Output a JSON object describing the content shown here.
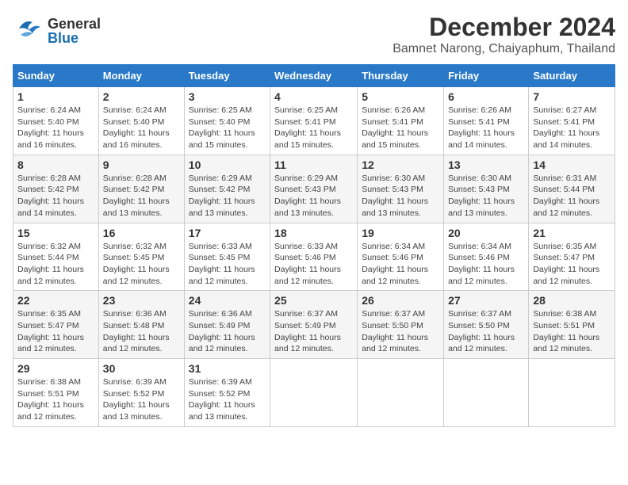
{
  "header": {
    "logo": {
      "general": "General",
      "blue": "Blue"
    },
    "month": "December 2024",
    "location": "Bamnet Narong, Chaiyaphum, Thailand"
  },
  "weekdays": [
    "Sunday",
    "Monday",
    "Tuesday",
    "Wednesday",
    "Thursday",
    "Friday",
    "Saturday"
  ],
  "weeks": [
    [
      {
        "day": "1",
        "sunrise": "Sunrise: 6:24 AM",
        "sunset": "Sunset: 5:40 PM",
        "daylight": "Daylight: 11 hours and 16 minutes."
      },
      {
        "day": "2",
        "sunrise": "Sunrise: 6:24 AM",
        "sunset": "Sunset: 5:40 PM",
        "daylight": "Daylight: 11 hours and 16 minutes."
      },
      {
        "day": "3",
        "sunrise": "Sunrise: 6:25 AM",
        "sunset": "Sunset: 5:40 PM",
        "daylight": "Daylight: 11 hours and 15 minutes."
      },
      {
        "day": "4",
        "sunrise": "Sunrise: 6:25 AM",
        "sunset": "Sunset: 5:41 PM",
        "daylight": "Daylight: 11 hours and 15 minutes."
      },
      {
        "day": "5",
        "sunrise": "Sunrise: 6:26 AM",
        "sunset": "Sunset: 5:41 PM",
        "daylight": "Daylight: 11 hours and 15 minutes."
      },
      {
        "day": "6",
        "sunrise": "Sunrise: 6:26 AM",
        "sunset": "Sunset: 5:41 PM",
        "daylight": "Daylight: 11 hours and 14 minutes."
      },
      {
        "day": "7",
        "sunrise": "Sunrise: 6:27 AM",
        "sunset": "Sunset: 5:41 PM",
        "daylight": "Daylight: 11 hours and 14 minutes."
      }
    ],
    [
      {
        "day": "8",
        "sunrise": "Sunrise: 6:28 AM",
        "sunset": "Sunset: 5:42 PM",
        "daylight": "Daylight: 11 hours and 14 minutes."
      },
      {
        "day": "9",
        "sunrise": "Sunrise: 6:28 AM",
        "sunset": "Sunset: 5:42 PM",
        "daylight": "Daylight: 11 hours and 13 minutes."
      },
      {
        "day": "10",
        "sunrise": "Sunrise: 6:29 AM",
        "sunset": "Sunset: 5:42 PM",
        "daylight": "Daylight: 11 hours and 13 minutes."
      },
      {
        "day": "11",
        "sunrise": "Sunrise: 6:29 AM",
        "sunset": "Sunset: 5:43 PM",
        "daylight": "Daylight: 11 hours and 13 minutes."
      },
      {
        "day": "12",
        "sunrise": "Sunrise: 6:30 AM",
        "sunset": "Sunset: 5:43 PM",
        "daylight": "Daylight: 11 hours and 13 minutes."
      },
      {
        "day": "13",
        "sunrise": "Sunrise: 6:30 AM",
        "sunset": "Sunset: 5:43 PM",
        "daylight": "Daylight: 11 hours and 13 minutes."
      },
      {
        "day": "14",
        "sunrise": "Sunrise: 6:31 AM",
        "sunset": "Sunset: 5:44 PM",
        "daylight": "Daylight: 11 hours and 12 minutes."
      }
    ],
    [
      {
        "day": "15",
        "sunrise": "Sunrise: 6:32 AM",
        "sunset": "Sunset: 5:44 PM",
        "daylight": "Daylight: 11 hours and 12 minutes."
      },
      {
        "day": "16",
        "sunrise": "Sunrise: 6:32 AM",
        "sunset": "Sunset: 5:45 PM",
        "daylight": "Daylight: 11 hours and 12 minutes."
      },
      {
        "day": "17",
        "sunrise": "Sunrise: 6:33 AM",
        "sunset": "Sunset: 5:45 PM",
        "daylight": "Daylight: 11 hours and 12 minutes."
      },
      {
        "day": "18",
        "sunrise": "Sunrise: 6:33 AM",
        "sunset": "Sunset: 5:46 PM",
        "daylight": "Daylight: 11 hours and 12 minutes."
      },
      {
        "day": "19",
        "sunrise": "Sunrise: 6:34 AM",
        "sunset": "Sunset: 5:46 PM",
        "daylight": "Daylight: 11 hours and 12 minutes."
      },
      {
        "day": "20",
        "sunrise": "Sunrise: 6:34 AM",
        "sunset": "Sunset: 5:46 PM",
        "daylight": "Daylight: 11 hours and 12 minutes."
      },
      {
        "day": "21",
        "sunrise": "Sunrise: 6:35 AM",
        "sunset": "Sunset: 5:47 PM",
        "daylight": "Daylight: 11 hours and 12 minutes."
      }
    ],
    [
      {
        "day": "22",
        "sunrise": "Sunrise: 6:35 AM",
        "sunset": "Sunset: 5:47 PM",
        "daylight": "Daylight: 11 hours and 12 minutes."
      },
      {
        "day": "23",
        "sunrise": "Sunrise: 6:36 AM",
        "sunset": "Sunset: 5:48 PM",
        "daylight": "Daylight: 11 hours and 12 minutes."
      },
      {
        "day": "24",
        "sunrise": "Sunrise: 6:36 AM",
        "sunset": "Sunset: 5:49 PM",
        "daylight": "Daylight: 11 hours and 12 minutes."
      },
      {
        "day": "25",
        "sunrise": "Sunrise: 6:37 AM",
        "sunset": "Sunset: 5:49 PM",
        "daylight": "Daylight: 11 hours and 12 minutes."
      },
      {
        "day": "26",
        "sunrise": "Sunrise: 6:37 AM",
        "sunset": "Sunset: 5:50 PM",
        "daylight": "Daylight: 11 hours and 12 minutes."
      },
      {
        "day": "27",
        "sunrise": "Sunrise: 6:37 AM",
        "sunset": "Sunset: 5:50 PM",
        "daylight": "Daylight: 11 hours and 12 minutes."
      },
      {
        "day": "28",
        "sunrise": "Sunrise: 6:38 AM",
        "sunset": "Sunset: 5:51 PM",
        "daylight": "Daylight: 11 hours and 12 minutes."
      }
    ],
    [
      {
        "day": "29",
        "sunrise": "Sunrise: 6:38 AM",
        "sunset": "Sunset: 5:51 PM",
        "daylight": "Daylight: 11 hours and 12 minutes."
      },
      {
        "day": "30",
        "sunrise": "Sunrise: 6:39 AM",
        "sunset": "Sunset: 5:52 PM",
        "daylight": "Daylight: 11 hours and 13 minutes."
      },
      {
        "day": "31",
        "sunrise": "Sunrise: 6:39 AM",
        "sunset": "Sunset: 5:52 PM",
        "daylight": "Daylight: 11 hours and 13 minutes."
      },
      null,
      null,
      null,
      null
    ]
  ]
}
